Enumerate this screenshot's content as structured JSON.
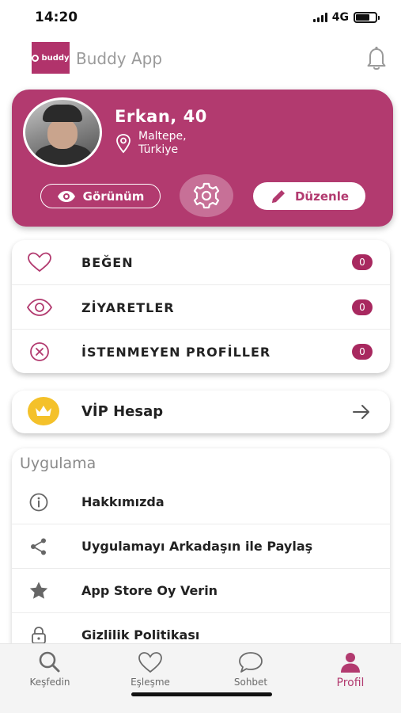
{
  "status_bar": {
    "time": "14:20",
    "network": "4G",
    "battery_level": 0.7
  },
  "header": {
    "logo_text": "buddy",
    "app_title": "Buddy App",
    "icon": "bell-icon"
  },
  "profile": {
    "name_age": "Erkan, 40",
    "location_line1": "Maltepe,",
    "location_line2": "Türkiye",
    "view_label": "Görünüm",
    "edit_label": "Düzenle",
    "accent_color": "#b23a6f"
  },
  "stats": [
    {
      "label": "BEĞEN",
      "count": "0",
      "icon": "heart-icon"
    },
    {
      "label": "ZİYARETLER",
      "count": "0",
      "icon": "eye-icon"
    },
    {
      "label": "İSTENMEYEN PROFİLLER",
      "count": "0",
      "icon": "block-icon"
    }
  ],
  "vip": {
    "label": "VİP Hesap",
    "icon": "crown-icon"
  },
  "app_section": {
    "title": "Uygulama",
    "items": [
      {
        "label": "Hakkımızda",
        "icon": "info-icon"
      },
      {
        "label": "Uygulamayı Arkadaşın ile Paylaş",
        "icon": "share-icon"
      },
      {
        "label": "App Store Oy Verin",
        "icon": "star-icon"
      },
      {
        "label": "Gizlilik Politikası",
        "icon": "lock-icon"
      }
    ]
  },
  "tabs": [
    {
      "label": "Keşfedin",
      "icon": "search-icon",
      "active": false
    },
    {
      "label": "Eşleşme",
      "icon": "heart-icon",
      "active": false
    },
    {
      "label": "Sohbet",
      "icon": "chat-icon",
      "active": false
    },
    {
      "label": "Profil",
      "icon": "user-icon",
      "active": true
    }
  ]
}
